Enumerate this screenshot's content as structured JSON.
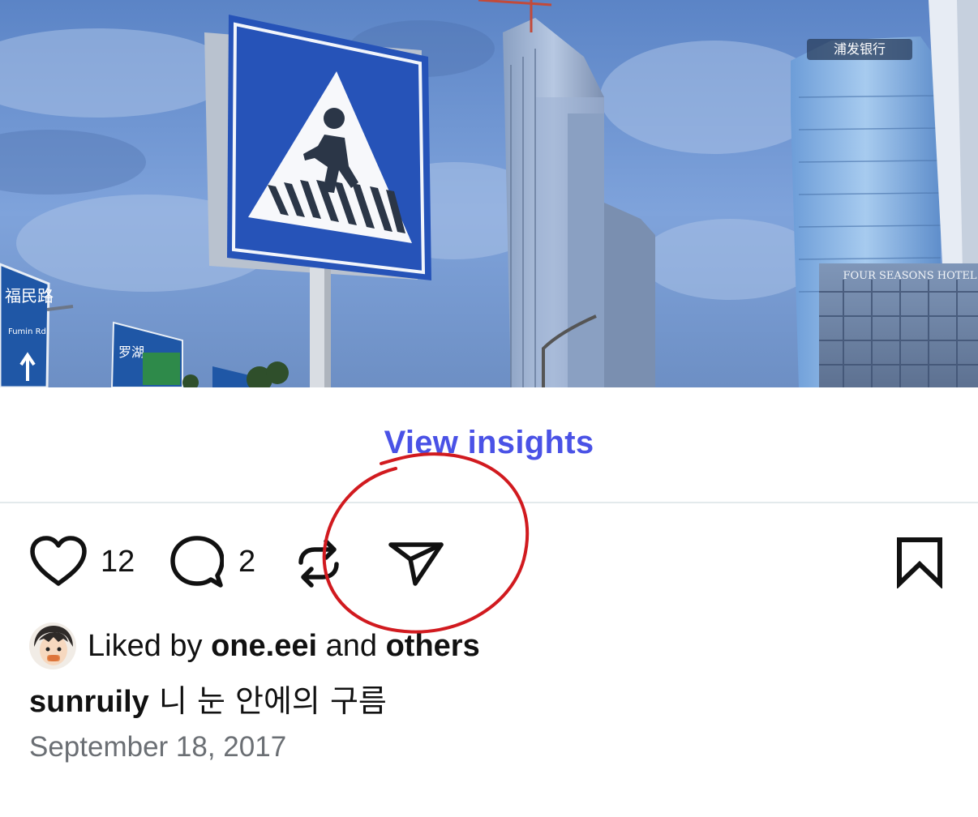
{
  "photo": {
    "alt_subject": "pedestrian-crossing-sign-and-skyscrapers",
    "bank_sign": "浦发银行",
    "hotel_sign": "FOUR SEASONS HOTEL",
    "street_sign_1": "福民路",
    "street_sign_1_sub": "Fumin Rd",
    "street_sign_2": "罗湖",
    "colors": {
      "sky_top": "#5f88c9",
      "sky_bottom": "#8fb0e0",
      "sign_blue": "#2653b8",
      "road_sign_blue": "#1f57a6"
    }
  },
  "insights": {
    "label": "View insights",
    "color": "#4a52e6"
  },
  "actions": {
    "like": {
      "icon": "heart-icon",
      "count": "12"
    },
    "comment": {
      "icon": "comment-icon",
      "count": "2"
    },
    "repost": {
      "icon": "repost-icon"
    },
    "share": {
      "icon": "send-icon"
    },
    "save": {
      "icon": "bookmark-icon"
    }
  },
  "annotation": {
    "icon": "red-circle-annotation",
    "color": "#d11a1f"
  },
  "likes": {
    "prefix": "Liked by ",
    "user": "one.eei",
    "middle": " and ",
    "others": "others"
  },
  "caption": {
    "username": "sunruily",
    "text": "니 눈 안에의 구름"
  },
  "date": "September 18, 2017"
}
